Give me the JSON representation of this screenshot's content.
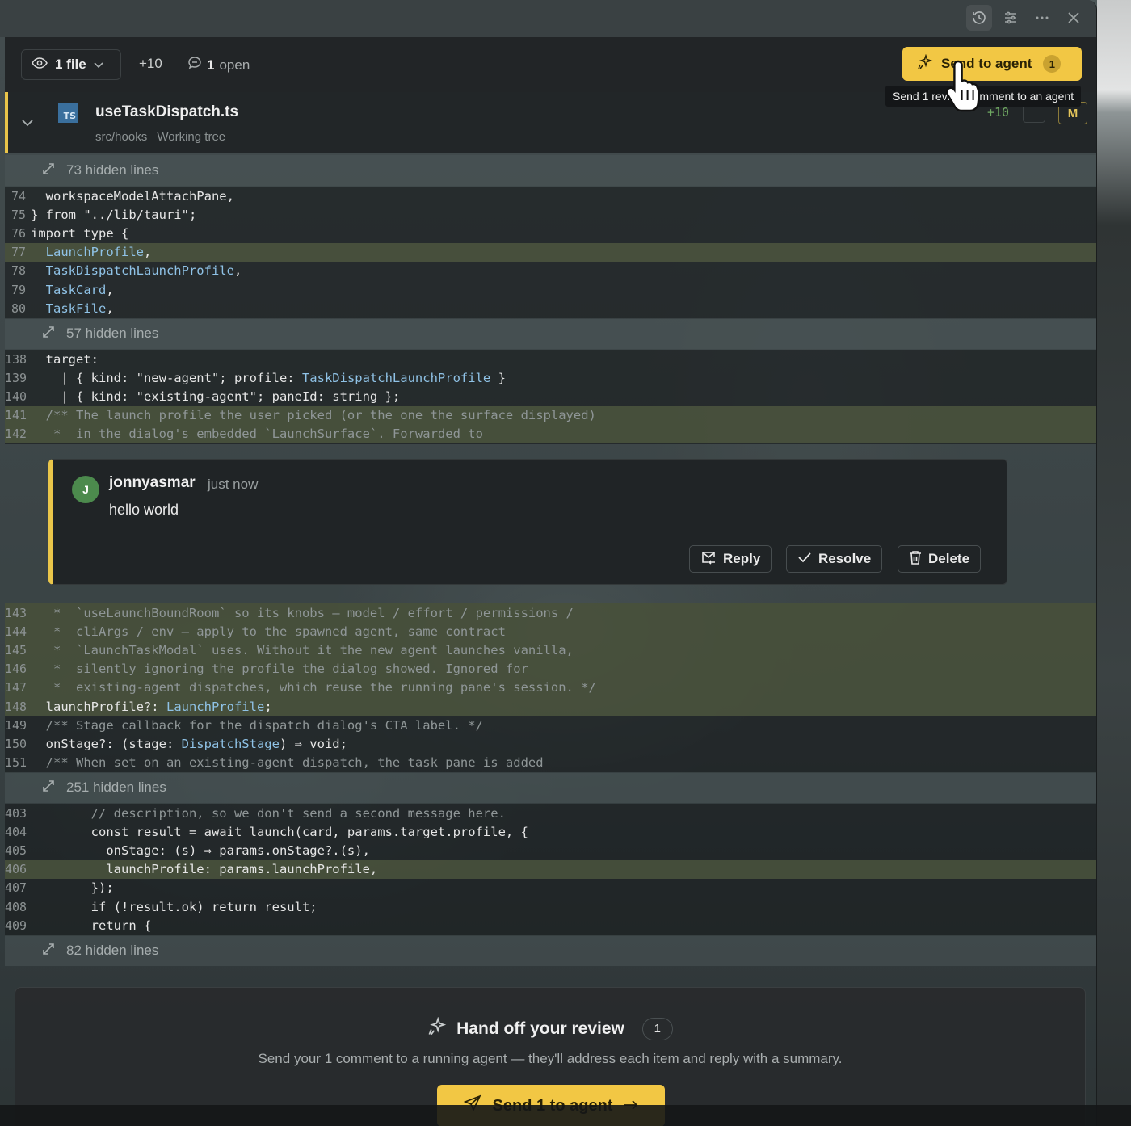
{
  "toolbar": {
    "files_label": "1 file",
    "additions": "+10",
    "open_count": "1",
    "open_label": "open",
    "send_label": "Send to agent",
    "send_badge": "1",
    "tooltip": "Send 1 review comment to an agent"
  },
  "file": {
    "name": "useTaskDispatch.ts",
    "dir": "src/hooks",
    "state": "Working tree",
    "additions": "+10",
    "status": "M",
    "lang_icon": "TS"
  },
  "hidden": {
    "h1": "73 hidden lines",
    "h2": "57 hidden lines",
    "h3": "251 hidden lines",
    "h4": "82 hidden lines"
  },
  "blocks": {
    "b1": [
      {
        "n": "74",
        "code": "  workspaceModelAttachPane,",
        "hl": false,
        "kind": "plain"
      },
      {
        "n": "75",
        "code": "} from \"../lib/tauri\";",
        "hl": false,
        "kind": "plain"
      },
      {
        "n": "76",
        "code": "import type {",
        "hl": false,
        "kind": "plain"
      },
      {
        "n": "77",
        "code": "  LaunchProfile,",
        "hl": true,
        "kind": "type"
      },
      {
        "n": "78",
        "code": "  TaskDispatchLaunchProfile,",
        "hl": false,
        "kind": "type"
      },
      {
        "n": "79",
        "code": "  TaskCard,",
        "hl": false,
        "kind": "type"
      },
      {
        "n": "80",
        "code": "  TaskFile,",
        "hl": false,
        "kind": "type"
      }
    ],
    "b2": [
      {
        "n": "138",
        "code": "  target:",
        "hl": false,
        "kind": "plain"
      },
      {
        "n": "139",
        "code": "    | { kind: \"new-agent\"; profile: TaskDispatchLaunchProfile }",
        "hl": false,
        "kind": "plain"
      },
      {
        "n": "140",
        "code": "    | { kind: \"existing-agent\"; paneId: string };",
        "hl": false,
        "kind": "plain"
      },
      {
        "n": "141",
        "code": "  /** The launch profile the user picked (or the one the surface displayed)",
        "hl": true,
        "kind": "comment"
      },
      {
        "n": "142",
        "code": "   *  in the dialog's embedded `LaunchSurface`. Forwarded to",
        "hl": true,
        "kind": "comment"
      }
    ],
    "b3": [
      {
        "n": "143",
        "code": "   *  `useLaunchBoundRoom` so its knobs — model / effort / permissions /",
        "hl": true,
        "kind": "comment"
      },
      {
        "n": "144",
        "code": "   *  cliArgs / env — apply to the spawned agent, same contract",
        "hl": true,
        "kind": "comment"
      },
      {
        "n": "145",
        "code": "   *  `LaunchTaskModal` uses. Without it the new agent launches vanilla,",
        "hl": true,
        "kind": "comment"
      },
      {
        "n": "146",
        "code": "   *  silently ignoring the profile the dialog showed. Ignored for",
        "hl": true,
        "kind": "comment"
      },
      {
        "n": "147",
        "code": "   *  existing-agent dispatches, which reuse the running pane's session. */",
        "hl": true,
        "kind": "comment"
      },
      {
        "n": "148",
        "code": "  launchProfile?: LaunchProfile;",
        "hl": true,
        "kind": "plain"
      },
      {
        "n": "149",
        "code": "  /** Stage callback for the dispatch dialog's CTA label. */",
        "hl": false,
        "kind": "comment"
      },
      {
        "n": "150",
        "code": "  onStage?: (stage: DispatchStage) ⇒ void;",
        "hl": false,
        "kind": "plain"
      },
      {
        "n": "151",
        "code": "  /** When set on an existing-agent dispatch, the task pane is added",
        "hl": false,
        "kind": "comment"
      }
    ],
    "b4": [
      {
        "n": "403",
        "code": "        // description, so we don't send a second message here.",
        "hl": false,
        "kind": "comment"
      },
      {
        "n": "404",
        "code": "        const result = await launch(card, params.target.profile, {",
        "hl": false,
        "kind": "plain"
      },
      {
        "n": "405",
        "code": "          onStage: (s) ⇒ params.onStage?.(s),",
        "hl": false,
        "kind": "plain"
      },
      {
        "n": "406",
        "code": "          launchProfile: params.launchProfile,",
        "hl": true,
        "kind": "plain"
      },
      {
        "n": "407",
        "code": "        });",
        "hl": false,
        "kind": "plain"
      },
      {
        "n": "408",
        "code": "        if (!result.ok) return result;",
        "hl": false,
        "kind": "plain"
      },
      {
        "n": "409",
        "code": "        return {",
        "hl": false,
        "kind": "plain"
      }
    ]
  },
  "comment": {
    "avatar_initial": "J",
    "author": "jonnyasmar",
    "time": "just now",
    "body": "hello world",
    "reply_label": "Reply",
    "resolve_label": "Resolve",
    "delete_label": "Delete"
  },
  "handoff": {
    "title": "Hand off your review",
    "count": "1",
    "subtitle": "Send your 1 comment to a running agent — they'll address each item and reply with a summary.",
    "button_label": "Send 1 to agent"
  },
  "colors": {
    "accent": "#f2c744",
    "type": "#8fc2e6",
    "highlight": "#626e48"
  },
  "icons": [
    "history-icon",
    "sliders-icon",
    "more-icon",
    "close-icon",
    "eye-icon",
    "chevron-down-icon",
    "comment-icon",
    "sparkle-icon",
    "expand-icon",
    "reply-icon",
    "check-icon",
    "trash-icon",
    "send-icon",
    "arrow-right-icon"
  ]
}
